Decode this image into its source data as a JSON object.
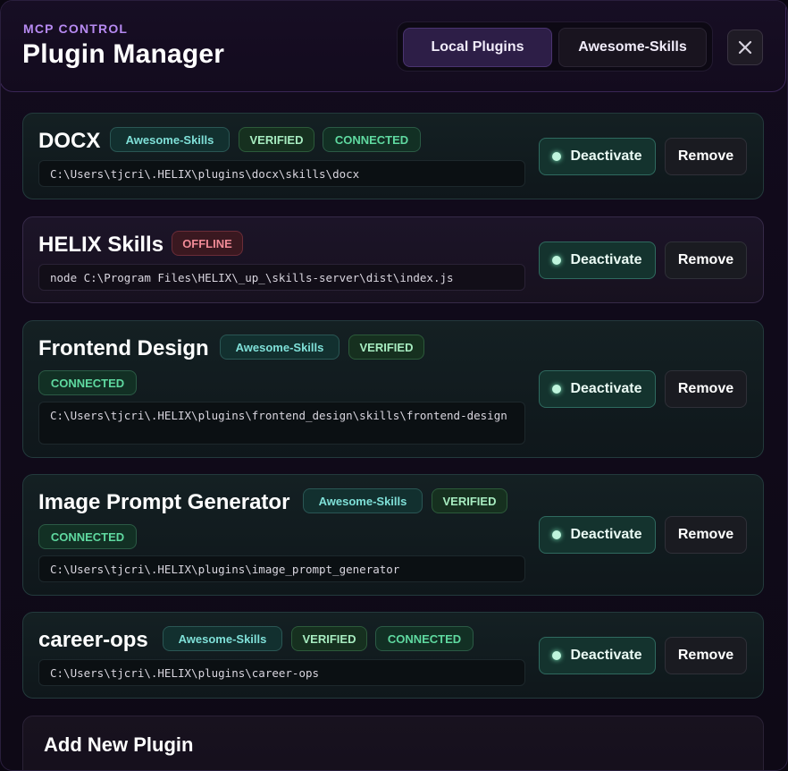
{
  "header": {
    "eyebrow": "MCP CONTROL",
    "title": "Plugin Manager",
    "tabs": [
      {
        "label": "Local Plugins",
        "active": true
      },
      {
        "label": "Awesome-Skills",
        "active": false
      }
    ],
    "close_icon": "close-icon"
  },
  "actions": {
    "deactivate_label": "Deactivate",
    "remove_label": "Remove"
  },
  "plugins": [
    {
      "name": "DOCX",
      "source": "Awesome-Skills",
      "verified": "VERIFIED",
      "status": "CONNECTED",
      "path": "C:\\Users\\tjcri\\.HELIX\\plugins\\docx\\skills\\docx"
    },
    {
      "name": "HELIX Skills",
      "status": "OFFLINE",
      "path": "node C:\\Program Files\\HELIX\\_up_\\skills-server\\dist\\index.js"
    },
    {
      "name": "Frontend Design",
      "source": "Awesome-Skills",
      "verified": "VERIFIED",
      "status": "CONNECTED",
      "path": "C:\\Users\\tjcri\\.HELIX\\plugins\\frontend_design\\skills\\frontend-design"
    },
    {
      "name": "Image Prompt Generator",
      "source": "Awesome-Skills",
      "verified": "VERIFIED",
      "status": "CONNECTED",
      "path": "C:\\Users\\tjcri\\.HELIX\\plugins\\image_prompt_generator"
    },
    {
      "name": "career-ops",
      "source": "Awesome-Skills",
      "verified": "VERIFIED",
      "status": "CONNECTED",
      "path": "C:\\Users\\tjcri\\.HELIX\\plugins\\career-ops"
    }
  ],
  "add_section": {
    "title": "Add New Plugin"
  },
  "colors": {
    "accent": "#b78af2",
    "connected": "#5fd9a0",
    "offline": "#f08a96",
    "verified": "#a7ecc0",
    "source": "#7fe0d8"
  }
}
